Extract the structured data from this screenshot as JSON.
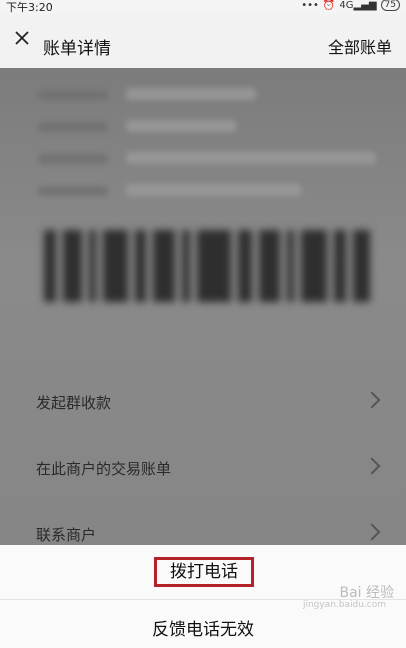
{
  "status_bar": {
    "time": "下午3:20",
    "signal": "4G",
    "battery": "75"
  },
  "header": {
    "title": "账单详情",
    "right_action": "全部账单"
  },
  "menu": [
    {
      "label": "发起群收款"
    },
    {
      "label": "在此商户的交易账单"
    },
    {
      "label": "联系商户"
    }
  ],
  "sheet": {
    "call_label": "拨打电话",
    "feedback_label": "反馈电话无效"
  },
  "watermark": {
    "main": "Bai 经验",
    "sub": "jingyan.baidu.com"
  },
  "colors": {
    "highlight_border": "#b5222a",
    "overlay": "#8a8a8a",
    "sheet_bg": "#fafafa"
  }
}
